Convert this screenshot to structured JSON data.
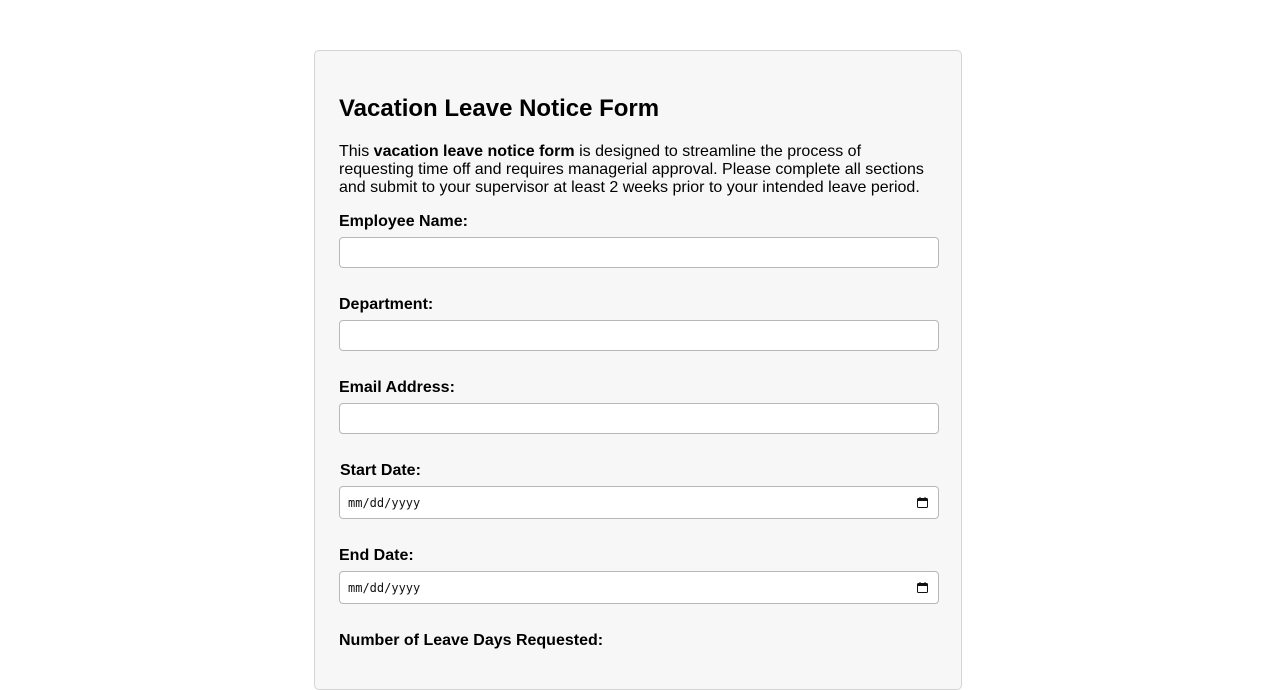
{
  "form": {
    "title": "Vacation Leave Notice Form",
    "intro": {
      "prefix": "This ",
      "bold": "vacation leave notice form",
      "suffix": " is designed to streamline the process of requesting time off and requires managerial approval. Please complete all sections and submit to your supervisor at least 2 weeks prior to your intended leave period."
    },
    "fields": {
      "employee_name": {
        "label": "Employee Name:",
        "value": ""
      },
      "department": {
        "label": "Department:",
        "value": ""
      },
      "email": {
        "label": "Email Address:",
        "value": ""
      },
      "start_date": {
        "label": "Start Date:",
        "placeholder": "mm/dd/yyyy"
      },
      "end_date": {
        "label": "End Date:",
        "placeholder": "mm/dd/yyyy"
      },
      "leave_days": {
        "label": "Number of Leave Days Requested:"
      }
    }
  },
  "icons": {
    "date_picker": "calendar-icon"
  },
  "colors": {
    "card_background": "#f7f7f7",
    "card_border": "#d4d4d4",
    "input_border": "#b8b8b8",
    "page_background": "#ffffff"
  }
}
